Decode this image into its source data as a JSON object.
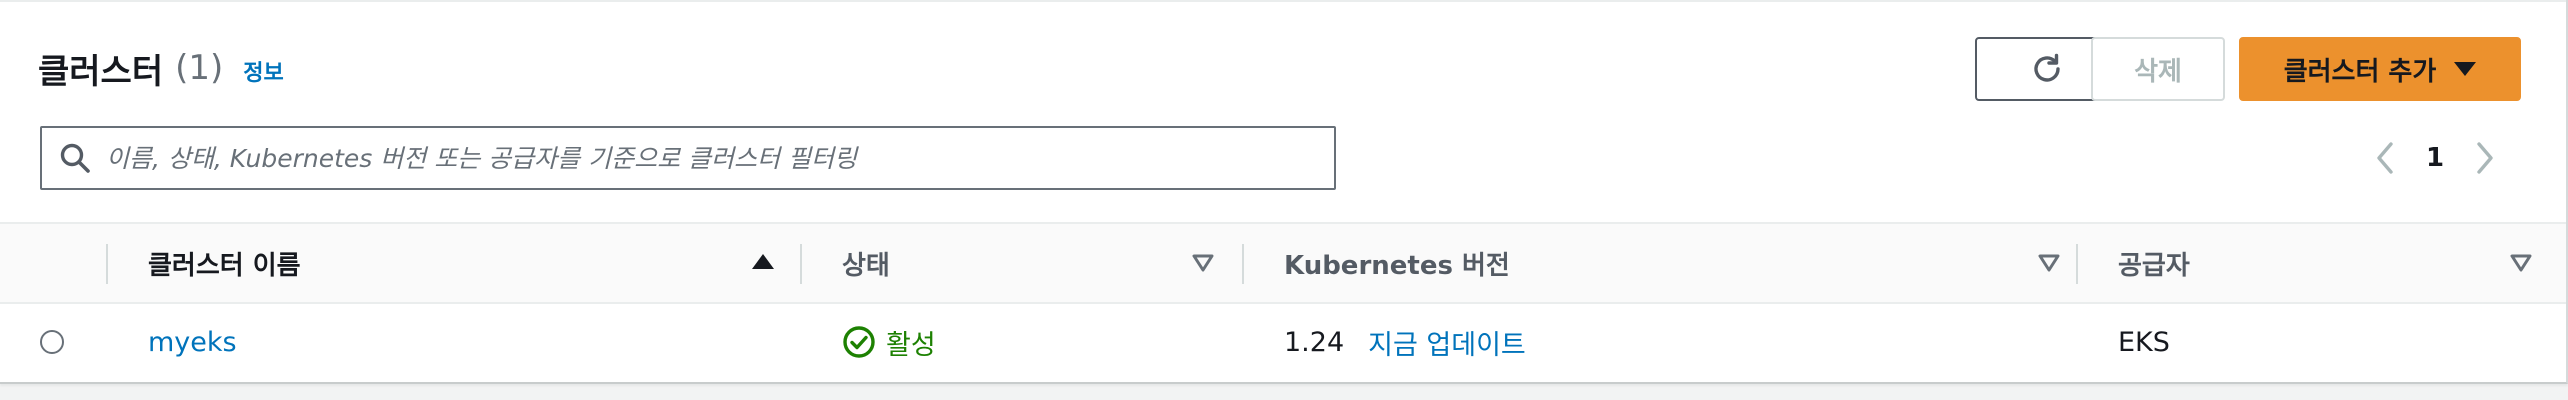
{
  "header": {
    "title": "클러스터",
    "count": "(1)",
    "info_link": "정보"
  },
  "actions": {
    "refresh_icon": "refresh-icon",
    "delete_label": "삭제",
    "add_label": "클러스터 추가"
  },
  "search": {
    "placeholder": "이름, 상태, Kubernetes 버전 또는 공급자를 기준으로 클러스터 필터링",
    "value": ""
  },
  "pagination": {
    "current_page": "1"
  },
  "table": {
    "columns": [
      "클러스터 이름",
      "상태",
      "Kubernetes 버전",
      "공급자"
    ],
    "rows": [
      {
        "name": "myeks",
        "status": "활성",
        "version": "1.24",
        "update_link": "지금 업데이트",
        "provider": "EKS"
      }
    ]
  },
  "colors": {
    "primary_button": "#ec912d",
    "link": "#0073bb",
    "success": "#1d8102"
  }
}
